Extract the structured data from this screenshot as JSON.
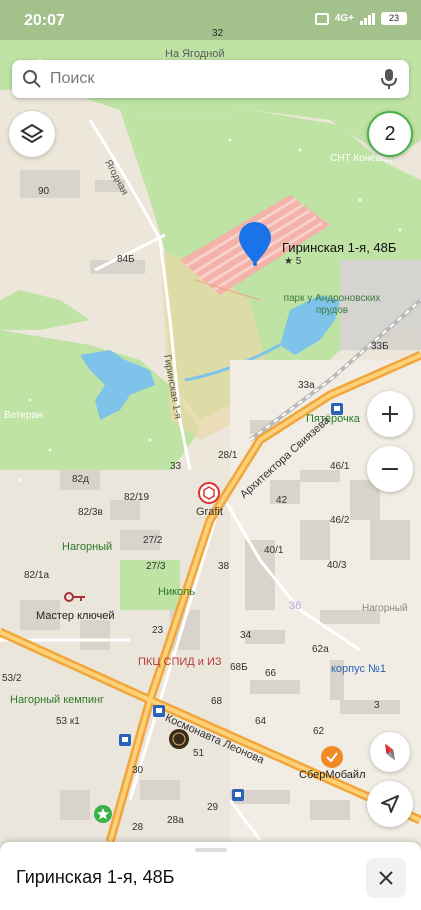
{
  "status_bar": {
    "time": "20:07",
    "network": "4G+",
    "battery": "23"
  },
  "search": {
    "placeholder": "Поиск"
  },
  "badge_count": "2",
  "selected": {
    "title": "Гиринская 1-я, 48Б",
    "rating": "★ 5"
  },
  "sheet": {
    "title": "Гиринская 1-я, 48Б"
  },
  "labels": {
    "n32": "32",
    "na_yagodnoy": "На Ягодной",
    "snt": "СНТ Коневод",
    "n90": "90",
    "yagodnaya": "Ягодная",
    "n84b": "84Б",
    "park": "парк у Андроновских прудов",
    "n33b": "33Б",
    "n33a": "33а",
    "veteran": "Ветеран",
    "girinskaya": "Гиринская 1-я",
    "pyaterochka": "Пятёрочка",
    "n28_1": "28/1",
    "n46_1": "46/1",
    "arkh": "Архитектора Свиязева",
    "n33": "33",
    "grafit": "Grafit",
    "n82d": "82д",
    "n82_19": "82/19",
    "n82_3v": "82/3в",
    "n42": "42",
    "n46_2": "46/2",
    "n27_2": "27/2",
    "nagorny": "Нагорный",
    "n40_1": "40/1",
    "n27_3": "27/3",
    "n38": "38",
    "n40_3": "40/3",
    "n82_1a": "82/1а",
    "nikol": "Николь",
    "n36": "36",
    "nagorny2": "Нагорный",
    "master": "Мастер ключей",
    "n23": "23",
    "n34": "34",
    "pkc": "ПКЦ СПИД и ИЗ",
    "n62a": "62а",
    "korpus": "корпус №1",
    "n53_2": "53/2",
    "n68b": "68Б",
    "n66": "66",
    "n3": "3",
    "camping": "Нагорный кемпинг",
    "n68": "68",
    "kosmonavta": "Космонавта Леонова",
    "n53_1": "53 к1",
    "n64": "64",
    "n62": "62",
    "n51": "51",
    "sbermobile": "СберМобайл",
    "n30": "30",
    "n29": "29",
    "n28a": "28а",
    "n28": "28"
  }
}
